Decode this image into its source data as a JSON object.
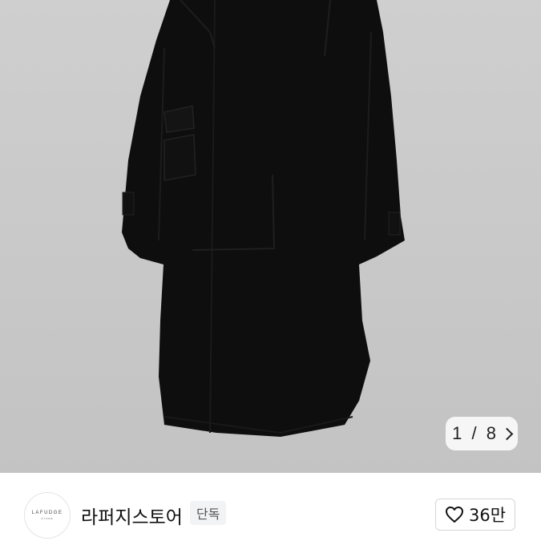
{
  "gallery": {
    "current_page": "1",
    "separator": "/",
    "total_pages": "8"
  },
  "shop": {
    "logo_text": "LAFUDGE",
    "logo_subtext": "STORE",
    "name": "라퍼지스토어",
    "badge": "단독",
    "likes": "36만"
  },
  "colors": {
    "coat": "#0d0d0d",
    "background": "#c8c8c8"
  }
}
